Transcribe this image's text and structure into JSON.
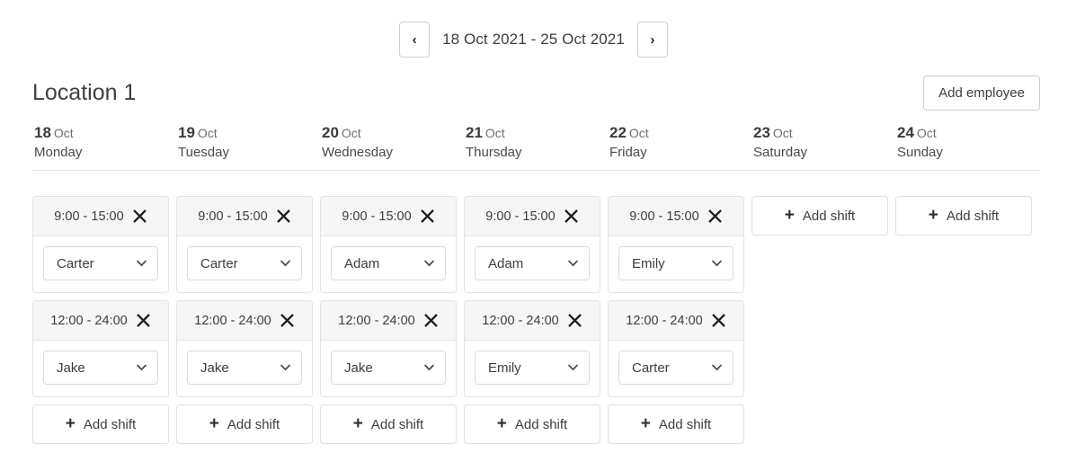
{
  "nav": {
    "prev_label": "‹",
    "next_label": "›",
    "range": "18 Oct 2021 - 25 Oct 2021"
  },
  "location": {
    "title": "Location 1",
    "add_employee_label": "Add employee"
  },
  "labels": {
    "add_shift": "Add shift",
    "plus": "+",
    "close": "✕"
  },
  "days": [
    {
      "num": "18",
      "month": "Oct",
      "weekday": "Monday",
      "shifts": [
        {
          "time": "9:00 - 15:00",
          "employee": "Carter"
        },
        {
          "time": "12:00 - 24:00",
          "employee": "Jake"
        }
      ],
      "add_shift": "Add shift"
    },
    {
      "num": "19",
      "month": "Oct",
      "weekday": "Tuesday",
      "shifts": [
        {
          "time": "9:00 - 15:00",
          "employee": "Carter"
        },
        {
          "time": "12:00 - 24:00",
          "employee": "Jake"
        }
      ],
      "add_shift": "Add shift"
    },
    {
      "num": "20",
      "month": "Oct",
      "weekday": "Wednesday",
      "shifts": [
        {
          "time": "9:00 - 15:00",
          "employee": "Adam"
        },
        {
          "time": "12:00 - 24:00",
          "employee": "Jake"
        }
      ],
      "add_shift": "Add shift"
    },
    {
      "num": "21",
      "month": "Oct",
      "weekday": "Thursday",
      "shifts": [
        {
          "time": "9:00 - 15:00",
          "employee": "Adam"
        },
        {
          "time": "12:00 - 24:00",
          "employee": "Emily"
        }
      ],
      "add_shift": "Add shift"
    },
    {
      "num": "22",
      "month": "Oct",
      "weekday": "Friday",
      "shifts": [
        {
          "time": "9:00 - 15:00",
          "employee": "Emily"
        },
        {
          "time": "12:00 - 24:00",
          "employee": "Carter"
        }
      ],
      "add_shift": "Add shift"
    },
    {
      "num": "23",
      "month": "Oct",
      "weekday": "Saturday",
      "shifts": [],
      "add_shift": "Add shift"
    },
    {
      "num": "24",
      "month": "Oct",
      "weekday": "Sunday",
      "shifts": [],
      "add_shift": "Add shift"
    }
  ],
  "employee_options": [
    "Carter",
    "Adam",
    "Emily",
    "Jake"
  ],
  "colors": {
    "border": "#e3e3e3",
    "shift_header_bg": "#f6f6f6",
    "text": "#3d3d3d",
    "muted": "#6d6d6d"
  }
}
